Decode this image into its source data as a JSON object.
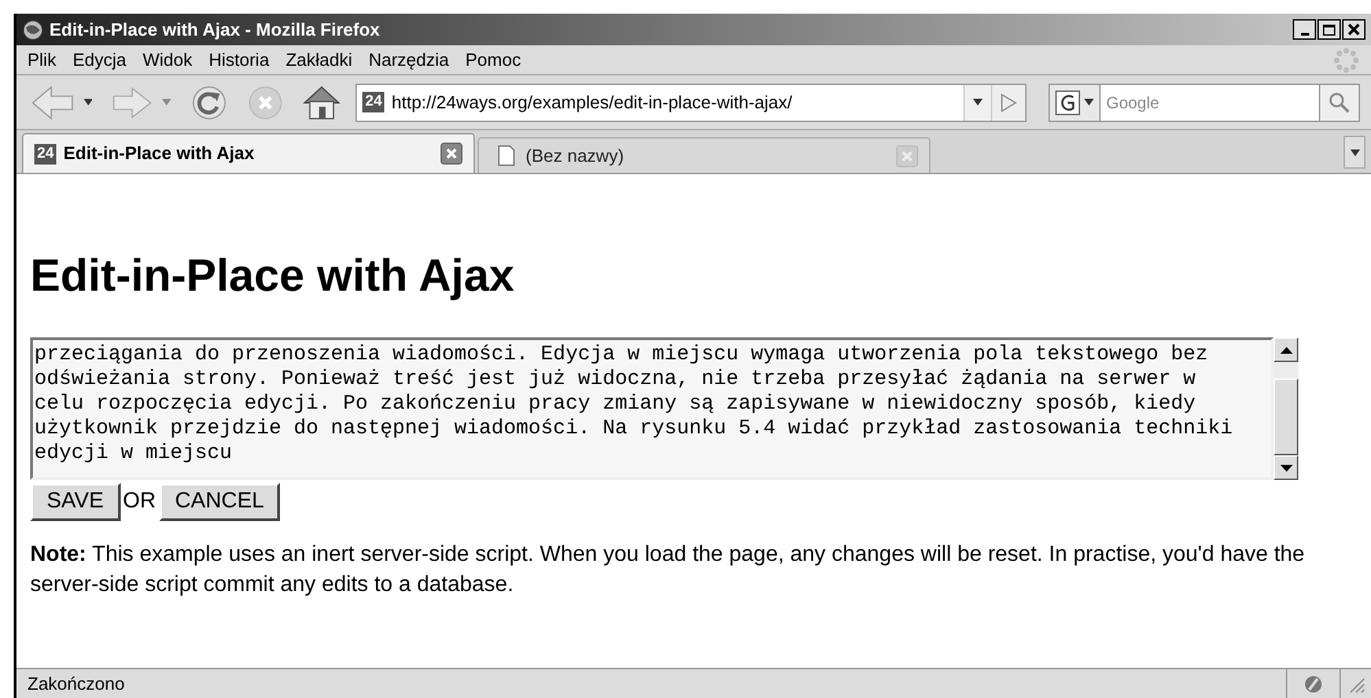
{
  "window": {
    "title": "Edit-in-Place with Ajax - Mozilla Firefox"
  },
  "menu": [
    "Plik",
    "Edycja",
    "Widok",
    "Historia",
    "Zakładki",
    "Narzędzia",
    "Pomoc"
  ],
  "toolbar": {
    "url": "http://24ways.org/examples/edit-in-place-with-ajax/",
    "site_badge": "24",
    "search_placeholder": "Google"
  },
  "tabs": [
    {
      "label": "Edit-in-Place with Ajax",
      "badge": "24",
      "selected": true
    },
    {
      "label": "(Bez nazwy)",
      "selected": false
    }
  ],
  "page": {
    "heading": "Edit-in-Place with Ajax",
    "editor_lines": [
      "przeciągania do przenoszenia wiadomości. Edycja w miejscu wymaga utworzenia pola tekstowego bez",
      "odświeżania strony. Ponieważ treść jest już widoczna, nie trzeba przesyłać żądania na serwer w",
      "celu rozpoczęcia edycji. Po zakończeniu pracy zmiany są zapisywane w niewidoczny sposób, kiedy",
      "użytkownik przejdzie do następnej wiadomości. Na rysunku 5.4 widać przykład zastosowania techniki",
      "edycji w miejscu"
    ],
    "save_button": "SAVE",
    "separator": "OR",
    "cancel_button": "CANCEL",
    "note": "**Note:** This example uses an inert server-side script. When you load the page, any changes will be reset. In practise, you'd have the server-side script commit any edits to a database."
  },
  "status_bar": {
    "text": "Zakończono"
  }
}
